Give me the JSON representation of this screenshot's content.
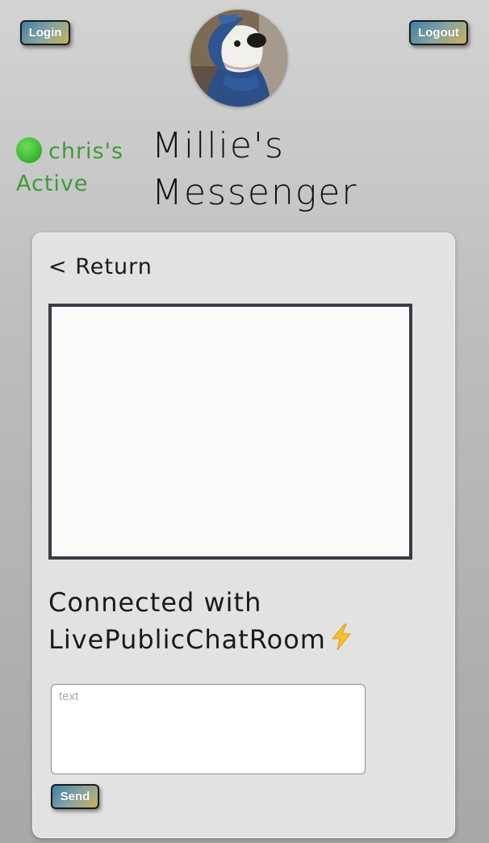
{
  "header": {
    "login_label": "Login",
    "logout_label": "Logout"
  },
  "user": {
    "name": "chris's",
    "status": "Active",
    "status_color": "#3f9a38"
  },
  "app": {
    "title_line1": "Millie's",
    "title_line2": "Messenger"
  },
  "chat": {
    "return_label": "< Return",
    "connected_line1": "Connected with",
    "connected_line2": "LivePublicChatRoom",
    "connected_icon": "lightning-bolt-icon",
    "input_placeholder": "text",
    "input_value": "",
    "send_label": "Send"
  },
  "colors": {
    "button_gradient": [
      "#3f7fa6",
      "#86a3a3",
      "#c7b257"
    ],
    "chatbox_border": "#3c3b45",
    "card_background": "#e2e2e2"
  }
}
